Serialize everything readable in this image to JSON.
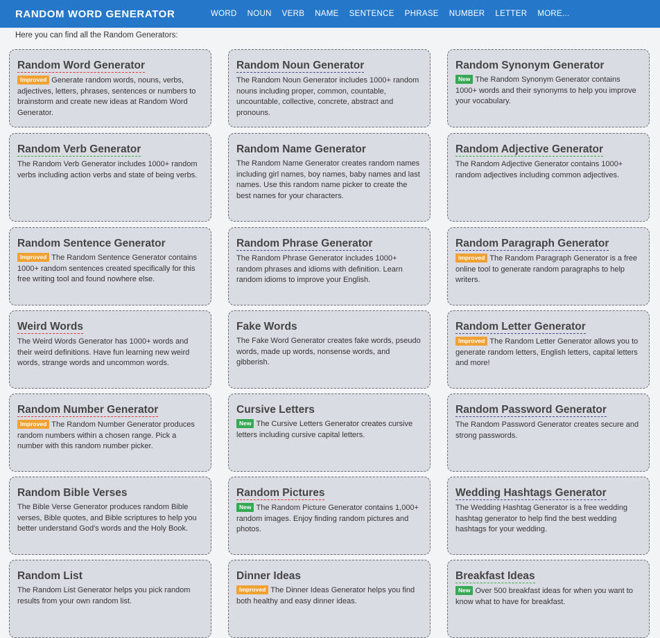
{
  "header": {
    "brand": "RANDOM WORD GENERATOR",
    "nav": [
      "WORD",
      "NOUN",
      "VERB",
      "NAME",
      "SENTENCE",
      "PHRASE",
      "NUMBER",
      "LETTER",
      "MORE..."
    ]
  },
  "intro": "Here you can find all the Random Generators:",
  "badges": {
    "improved": "Improved",
    "new": "New"
  },
  "colors": {
    "nav_bg": "#2477c9",
    "card_bg": "#d9dde3",
    "improved": "#f0a131",
    "new": "#35a853"
  },
  "cards": [
    {
      "title": "Random Word Generator",
      "badge": "improved",
      "desc": "Generate random words, nouns, verbs, adjectives, letters, phrases, sentences or numbers to brainstorm and create new ideas at Random Word Generator."
    },
    {
      "title": "Random Noun Generator",
      "badge": "",
      "desc": "The Random Noun Generator includes 1000+ random nouns including proper, common, countable, uncountable, collective, concrete, abstract and pronouns."
    },
    {
      "title": "Random Synonym Generator",
      "badge": "new",
      "desc": "The Random Synonym Generator contains 1000+ words and their synonyms to help you improve your vocabulary."
    },
    {
      "title": "Random Verb Generator",
      "badge": "",
      "desc": "The Random Verb Generator includes 1000+ random verbs including action verbs and state of being verbs."
    },
    {
      "title": "Random Name Generator",
      "badge": "",
      "desc": "The Random Name Generator creates random names including girl names, boy names, baby names and last names. Use this random name picker to create the best names for your characters."
    },
    {
      "title": "Random Adjective Generator",
      "badge": "",
      "desc": "The Random Adjective Generator contains 1000+ random adjectives including common adjectives."
    },
    {
      "title": "Random Sentence Generator",
      "badge": "improved",
      "desc": "The Random Sentence Generator contains 1000+ random sentences created specifically for this free writing tool and found nowhere else."
    },
    {
      "title": "Random Phrase Generator",
      "badge": "",
      "desc": "The Random Phrase Generator includes 1000+ random phrases and idioms with definition. Learn random idioms to improve your English."
    },
    {
      "title": "Random Paragraph Generator",
      "badge": "improved",
      "desc": "The Random Paragraph Generator is a free online tool to generate random paragraphs to help writers."
    },
    {
      "title": "Weird Words",
      "badge": "",
      "desc": "The Weird Words Generator has 1000+ words and their weird definitions. Have fun learning new weird words, strange words and uncommon words."
    },
    {
      "title": "Fake Words",
      "badge": "",
      "desc": "The Fake Word Generator creates fake words, pseudo words, made up words, nonsense words, and gibberish."
    },
    {
      "title": "Random Letter Generator",
      "badge": "improved",
      "desc": "The Random Letter Generator allows you to generate random letters, English letters, capital letters and more!"
    },
    {
      "title": "Random Number Generator",
      "badge": "improved",
      "desc": "The Random Number Generator produces random numbers within a chosen range. Pick a number with this random number picker."
    },
    {
      "title": "Cursive Letters",
      "badge": "new",
      "desc": "The Cursive Letters Generator creates cursive letters including cursive capital letters."
    },
    {
      "title": "Random Password Generator",
      "badge": "",
      "desc": "The Random Password Generator creates secure and strong passwords."
    },
    {
      "title": "Random Bible Verses",
      "badge": "",
      "desc": "The Bible Verse Generator produces random Bible verses, Bible quotes, and Bible scriptures to help you better understand God's words and the Holy Book."
    },
    {
      "title": "Random Pictures",
      "badge": "new",
      "desc": "The Random Picture Generator contains 1,000+ random images. Enjoy finding random pictures and photos."
    },
    {
      "title": "Wedding Hashtags Generator",
      "badge": "",
      "desc": "The Wedding Hashtag Generator is a free wedding hashtag generator to help find the best wedding hashtags for your wedding."
    },
    {
      "title": "Random List",
      "badge": "",
      "desc": "The Random List Generator helps you pick random results from your own random list."
    },
    {
      "title": "Dinner Ideas",
      "badge": "improved",
      "desc": "The Dinner Ideas Generator helps you find both healthy and easy dinner ideas."
    },
    {
      "title": "Breakfast Ideas",
      "badge": "new",
      "desc": "Over 500 breakfast ideas for when you want to know what to have for breakfast."
    }
  ]
}
